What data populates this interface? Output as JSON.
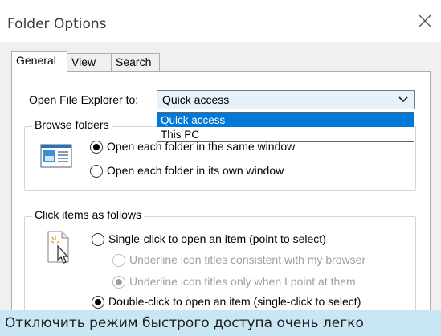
{
  "window": {
    "title": "Folder Options"
  },
  "tabs": [
    {
      "label": "General",
      "active": true
    },
    {
      "label": "View",
      "active": false
    },
    {
      "label": "Search",
      "active": false
    }
  ],
  "general": {
    "open_explorer_label": "Open File Explorer to:",
    "open_explorer_value": "Quick access",
    "dropdown_options": [
      "Quick access",
      "This PC"
    ],
    "browse_folders": {
      "title": "Browse folders",
      "options": [
        {
          "label": "Open each folder in the same window",
          "checked": true,
          "enabled": true
        },
        {
          "label": "Open each folder in its own window",
          "checked": false,
          "enabled": true
        }
      ]
    },
    "click_items": {
      "title": "Click items as follows",
      "options": [
        {
          "label": "Single-click to open an item (point to select)",
          "checked": false,
          "enabled": true
        },
        {
          "label": "Underline icon titles consistent with my browser",
          "checked": false,
          "enabled": false
        },
        {
          "label": "Underline icon titles only when I point at them",
          "checked": true,
          "enabled": false
        },
        {
          "label": "Double-click to open an item (single-click to select)",
          "checked": true,
          "enabled": true
        }
      ]
    }
  },
  "caption": "Отключить режим быстрого доступа очень легко",
  "colors": {
    "selection": "#0078d7",
    "caption_bg": "#c9e6f5",
    "combo_bg": "#e5f1fb"
  },
  "icons": [
    "close-icon",
    "chevron-down-icon",
    "folder-window-icon",
    "click-cursor-icon"
  ]
}
